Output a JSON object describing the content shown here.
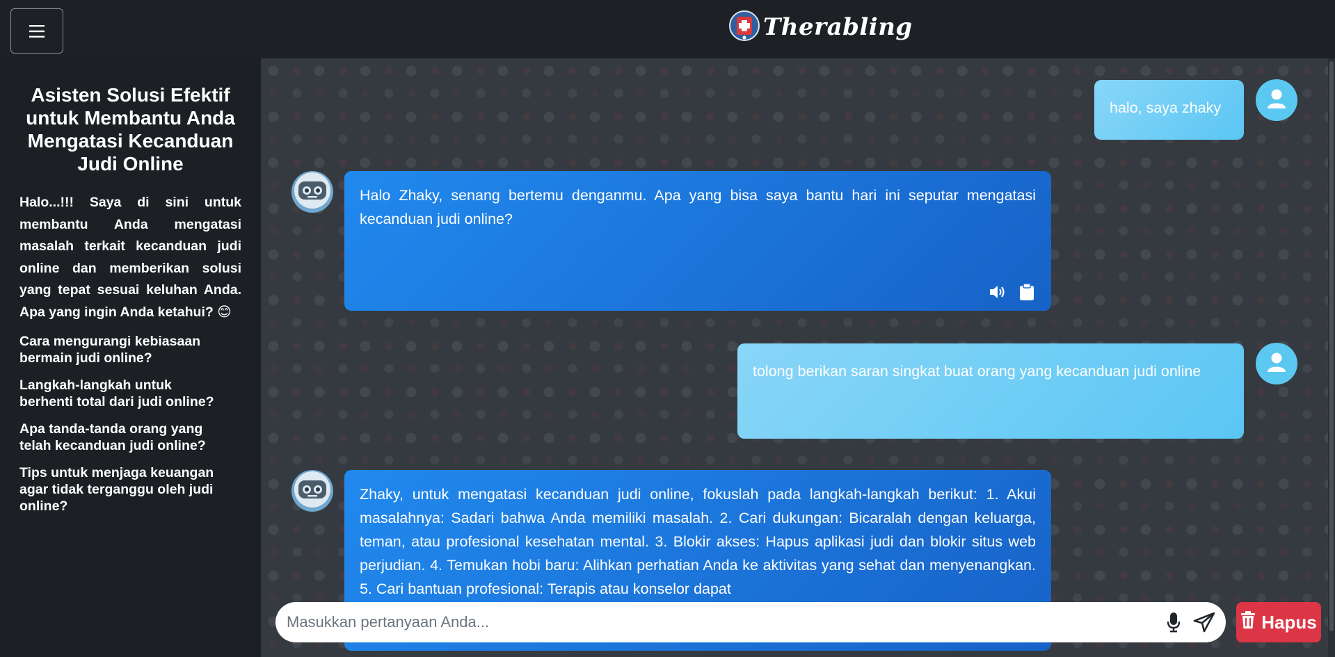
{
  "header": {
    "menu_icon": "hamburger-icon",
    "brand_name": "Therabling",
    "logo_icon": "robot-cross-logo"
  },
  "sidebar": {
    "title": "Asisten Solusi Efektif untuk Membantu Anda Mengatasi Kecanduan Judi Online",
    "intro": "Halo...!!! Saya di sini untuk membantu Anda mengatasi masalah terkait kecanduan judi online dan memberikan solusi yang tepat sesuai keluhan Anda. Apa yang ingin Anda ketahui? 😊",
    "suggestions": [
      "Cara mengurangi kebiasaan bermain judi online?",
      "Langkah-langkah untuk berhenti total dari judi online?",
      "Apa tanda-tanda orang yang telah kecanduan judi online?",
      "Tips untuk menjaga keuangan agar tidak terganggu oleh judi online?"
    ]
  },
  "messages": [
    {
      "role": "user",
      "text": "halo, saya zhaky"
    },
    {
      "role": "bot",
      "text": "Halo Zhaky, senang bertemu denganmu. Apa yang bisa saya bantu hari ini seputar mengatasi kecanduan judi online?"
    },
    {
      "role": "user",
      "text": "tolong berikan saran singkat buat orang yang kecanduan judi online"
    },
    {
      "role": "bot",
      "text": "Zhaky, untuk mengatasi kecanduan judi online, fokuslah pada langkah-langkah berikut: 1. Akui masalahnya: Sadari bahwa Anda memiliki masalah. 2. Cari dukungan: Bicaralah dengan keluarga, teman, atau profesional kesehatan mental. 3. Blokir akses: Hapus aplikasi judi dan blokir situs web perjudian. 4. Temukan hobi baru: Alihkan perhatian Anda ke aktivitas yang sehat dan menyenangkan. 5. Cari bantuan profesional: Terapis atau konselor dapat"
    }
  ],
  "composer": {
    "placeholder": "Masukkan pertanyaan Anda...",
    "mic_icon": "microphone-icon",
    "send_icon": "send-icon"
  },
  "clear_button": {
    "label": "Hapus",
    "icon": "trash-icon"
  },
  "colors": {
    "user_bubble": "#6ccdf6",
    "bot_bubble": "#1e7be0",
    "clear_button": "#dc3545",
    "sidebar_bg": "#1c2024"
  }
}
